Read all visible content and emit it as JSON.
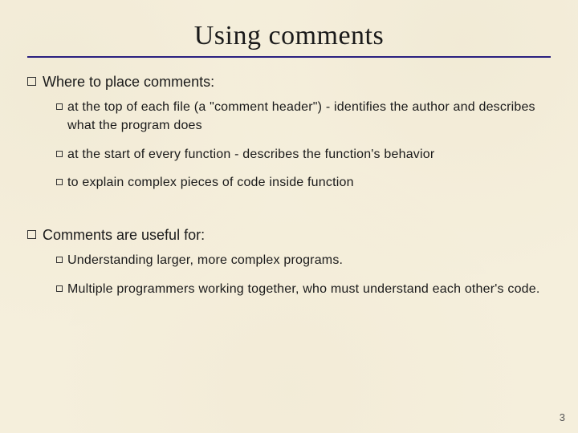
{
  "title": "Using comments",
  "sections": [
    {
      "heading": "Where to place comments:",
      "items": [
        "at the top of each file (a \"comment header\") - identifies the author and describes what the program does",
        "at the start of every function - describes the function's behavior",
        "to explain complex pieces of code inside function"
      ]
    },
    {
      "heading": "Comments are useful for:",
      "items": [
        "Understanding larger, more complex programs.",
        "Multiple programmers working together, who must understand each other's code."
      ]
    }
  ],
  "page_number": "3"
}
